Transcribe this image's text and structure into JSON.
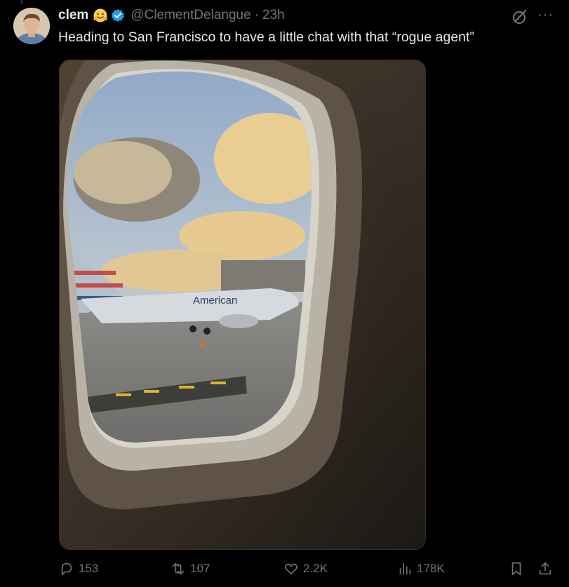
{
  "tweet": {
    "author_name": "clem",
    "author_emoji": "🤗",
    "handle": "@ClementDelangue",
    "separator": "·",
    "time": "23h",
    "text": "Heading to San Francisco to have a little chat with that “rogue agent”",
    "more_label": "···"
  },
  "media": {
    "airline_livery_text": "American"
  },
  "actions": {
    "replies": "153",
    "reposts": "107",
    "likes": "2.2K",
    "views": "178K"
  },
  "colors": {
    "background": "#000000",
    "text": "#e7e9ea",
    "muted": "#71767b",
    "verified": "#1d9bf0"
  },
  "icons": [
    "grok-icon",
    "more-icon",
    "reply-icon",
    "repost-icon",
    "like-icon",
    "views-icon",
    "bookmark-icon",
    "share-icon",
    "verified-badge-icon",
    "hugging-face-emoji"
  ]
}
